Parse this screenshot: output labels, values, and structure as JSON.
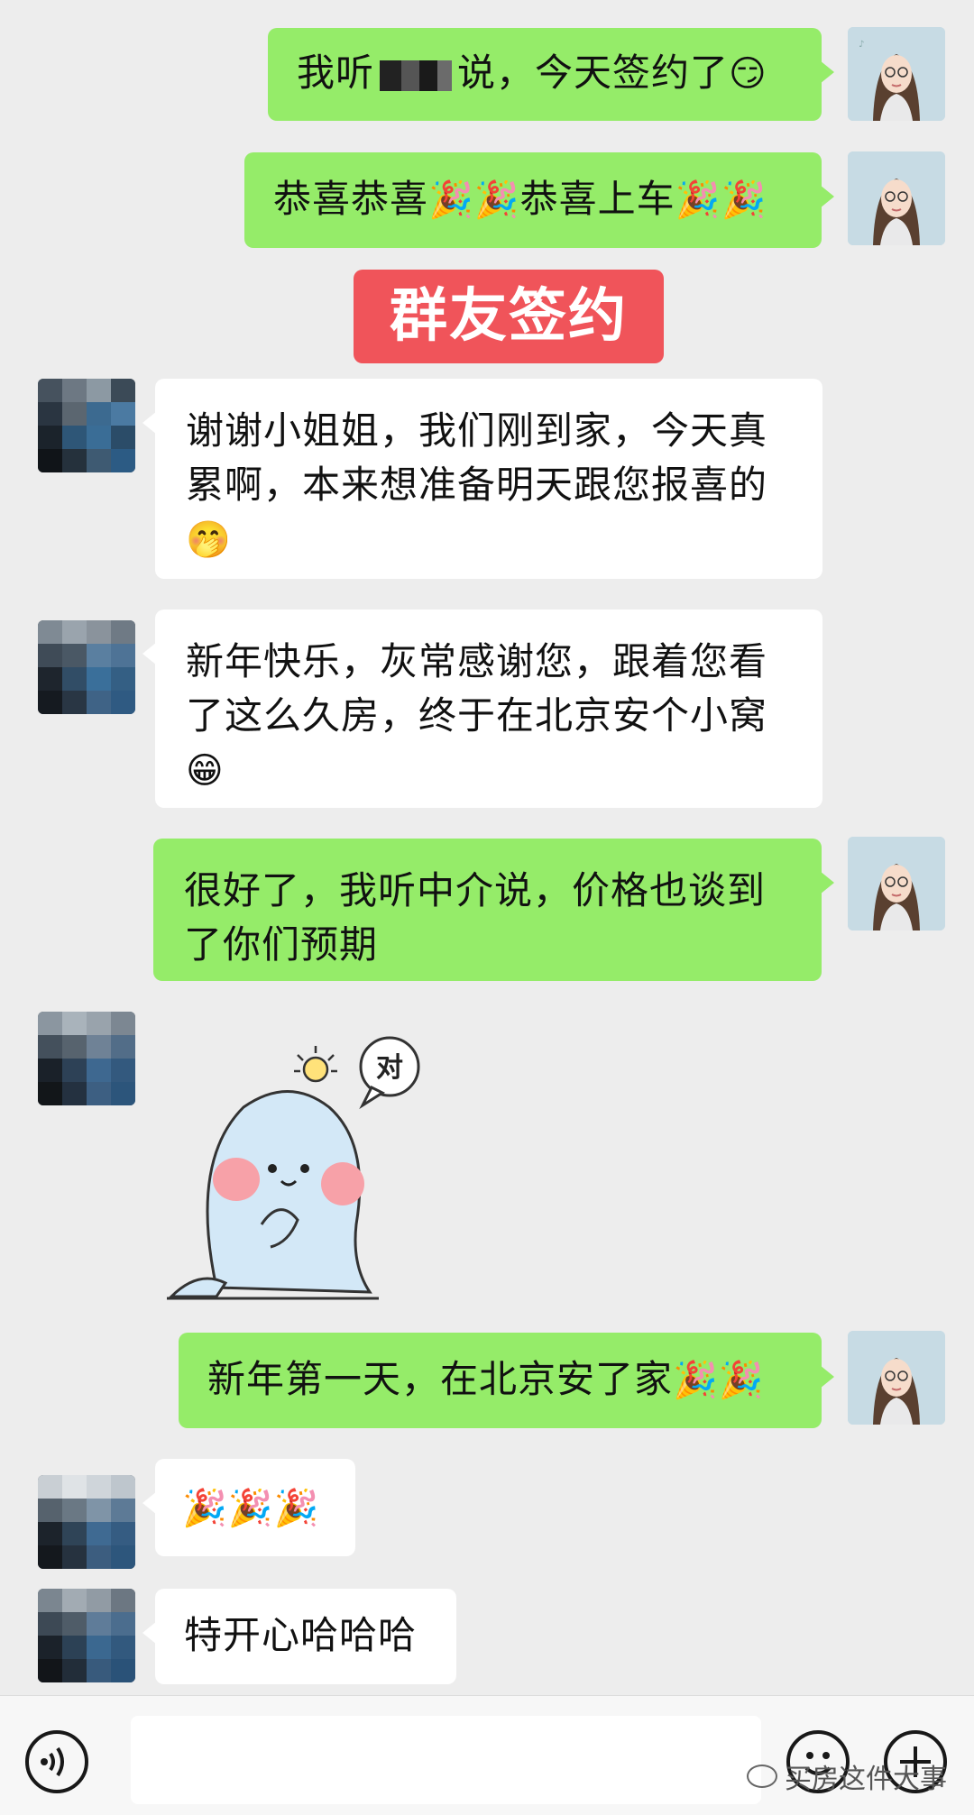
{
  "banner": {
    "label": "群友签约"
  },
  "messages": [
    {
      "side": "right",
      "text_before": "我听",
      "text_after": "说，今天签约了",
      "emoji": "😏"
    },
    {
      "side": "right",
      "text": "恭喜恭喜",
      "emoji_a": "🎉🎉",
      "text_b": "恭喜上车",
      "emoji_b": "🎉🎉"
    },
    {
      "side": "left",
      "text": "谢谢小姐姐，我们刚到家，今天真累啊，本来想准备明天跟您报喜的",
      "emoji": "🤭"
    },
    {
      "side": "left",
      "text": "新年快乐，灰常感谢您，跟着您看了这么久房，终于在北京安个小窝",
      "emoji": "😁"
    },
    {
      "side": "right",
      "text": "很好了，我听中介说，价格也谈到了你们预期"
    },
    {
      "side": "left",
      "sticker_text": "对"
    },
    {
      "side": "right",
      "text": "新年第一天，在北京安了家",
      "emoji": "🎉🎉"
    },
    {
      "side": "left",
      "emoji": "🎉🎉🎉"
    },
    {
      "side": "left",
      "text": "特开心哈哈哈"
    }
  ],
  "input_bar": {
    "voice_icon": "voice-icon",
    "emoji_icon": "emoji-icon",
    "plus_icon": "plus-icon"
  },
  "watermark": {
    "label": "买房这件大事"
  },
  "colors": {
    "background": "#ededed",
    "bubble_self": "#95ec69",
    "bubble_other": "#ffffff",
    "banner": "#f0545a"
  }
}
